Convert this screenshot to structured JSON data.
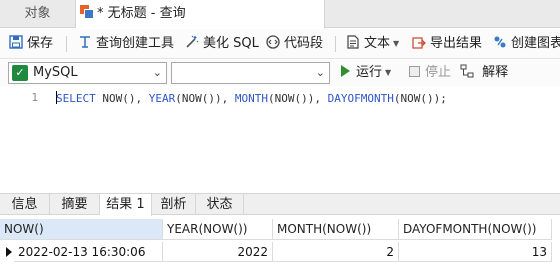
{
  "window_tabs": {
    "objects_label": "对象",
    "query_tab_label": "* 无标题 - 查询"
  },
  "toolbar": {
    "save": "保存",
    "query_builder": "查询创建工具",
    "beautify_sql": "美化 SQL",
    "code_snippet": "代码段",
    "text": "文本",
    "export_result": "导出结果",
    "create_chart": "创建图表"
  },
  "connection_bar": {
    "connection": "MySQL",
    "database": "",
    "run": "运行",
    "stop": "停止",
    "explain": "解释"
  },
  "editor": {
    "line_number": "1",
    "sql": {
      "select": "SELECT",
      "now": "NOW()",
      "sep1": ", ",
      "year": "YEAR",
      "year_arg": "(NOW())",
      "sep2": ", ",
      "month": "MONTH",
      "month_arg": "(NOW())",
      "sep3": ", ",
      "dayofmonth": "DAYOFMONTH",
      "dayofmonth_arg": "(NOW())",
      "end": ";"
    }
  },
  "result_tabs": [
    "信息",
    "摘要",
    "结果 1",
    "剖析",
    "状态"
  ],
  "grid": {
    "columns": [
      "NOW()",
      "YEAR(NOW())",
      "MONTH(NOW())",
      "DAYOFMONTH(NOW())"
    ],
    "rows": [
      [
        "2022-02-13 16:30:06",
        "2022",
        "2",
        "13"
      ]
    ]
  },
  "colors": {
    "accent": "#2f6fbf",
    "sql_keyword": "#2d56c6",
    "selected_header": "#dbe8f7",
    "run_green": "#2f8f2f"
  }
}
